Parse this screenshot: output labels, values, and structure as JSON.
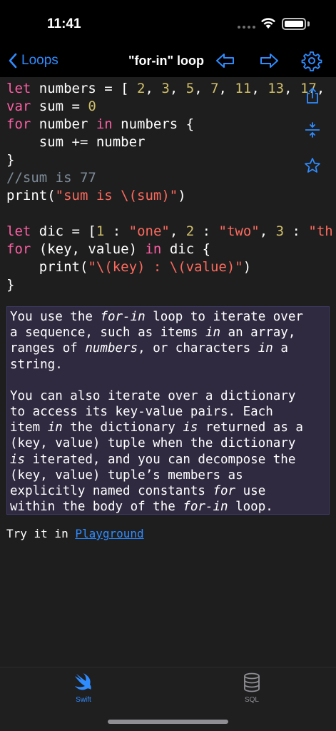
{
  "status": {
    "time": "11:41"
  },
  "nav": {
    "back_label": "Loops",
    "title": "\"for-in\" loop"
  },
  "code": {
    "l1": {
      "kw": "let",
      "a": " numbers = [ ",
      "n1": "2",
      "c1": ", ",
      "n2": "3",
      "c2": ", ",
      "n3": "5",
      "c3": ", ",
      "n4": "7",
      "c4": ", ",
      "n5": "11",
      "c5": ", ",
      "n6": "13",
      "c6": ", ",
      "n7": "17",
      "c7": ","
    },
    "l2": {
      "kw": "var",
      "a": " sum = ",
      "n": "0"
    },
    "l3": {
      "kw": "for",
      "a": " number ",
      "kw2": "in",
      "b": " numbers {"
    },
    "l4": "    sum += number",
    "l5": "}",
    "l6": "//sum is 77",
    "l7": {
      "a": "print(",
      "s": "\"sum is \\(sum)\"",
      "b": ")"
    },
    "l9": {
      "kw": "let",
      "a": " dic = [",
      "n1": "1",
      "b": " : ",
      "s1": "\"one\"",
      "c": ", ",
      "n2": "2",
      "d": " : ",
      "s2": "\"two\"",
      "e": ", ",
      "n3": "3",
      "f": " : ",
      "s3": "\"th"
    },
    "l10": {
      "kw": "for",
      "a": " (key, value) ",
      "kw2": "in",
      "b": " dic {"
    },
    "l11": {
      "a": "    print(",
      "s": "\"\\(key) : \\(value)\"",
      "b": ")"
    },
    "l12": "}"
  },
  "description": {
    "p1": [
      "You use the ",
      {
        "i": "for-in"
      },
      " loop to iterate over\na sequence, such as items ",
      {
        "i": "in"
      },
      " an array,\nranges of ",
      {
        "i": "numbers"
      },
      ", or characters ",
      {
        "i": "in"
      },
      " a\nstring."
    ],
    "p2": [
      "You can also iterate over a dictionary\nto access its key-value pairs. Each\nitem ",
      {
        "i": "in"
      },
      " the dictionary ",
      {
        "i": "is"
      },
      " returned as a\n(key, value) tuple when the dictionary\n",
      {
        "i": "is"
      },
      " iterated, and you can decompose the\n(key, value) tuple’s members as\nexplicitly named constants ",
      {
        "i": "for"
      },
      " use\nwithin the body of the ",
      {
        "i": "for-in"
      },
      " loop."
    ]
  },
  "playground": {
    "prefix": "Try it in ",
    "link": "Playground"
  },
  "tabs": [
    {
      "label": "Swift",
      "icon": "swift-icon",
      "selected": true
    },
    {
      "label": "SQL",
      "icon": "database-icon",
      "selected": false
    }
  ],
  "colors": {
    "accent": "#2f8cff",
    "keyword": "#fc5fa3",
    "number": "#d0bf69",
    "string": "#fc6a5d",
    "comment": "#7f8c98",
    "desc_bg": "#302a40"
  }
}
